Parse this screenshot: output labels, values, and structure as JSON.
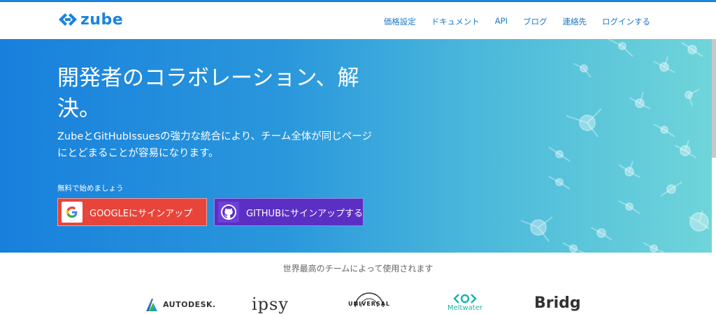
{
  "header": {
    "logo_text": "zube",
    "nav": [
      "価格設定",
      "ドキュメント",
      "API",
      "ブログ",
      "連絡先",
      "ログインする"
    ]
  },
  "hero": {
    "title": "開発者のコラボレーション、解決。",
    "subtitle": "ZubeとGitHubIssuesの強力な統合により、チーム全体が同じページにとどまることが容易になります。",
    "free_label": "無料で始めましょう",
    "google_button": "GOOGLEにサインアップ",
    "github_button": "GITHUBにサインアップする"
  },
  "trust": {
    "caption": "世界最高のチームによって使用されます",
    "logos": [
      "AUTODESK.",
      "ipsy",
      "UNIVERSAL",
      "Meltwater",
      "Bridg"
    ]
  },
  "colors": {
    "brand": "#1a84dd",
    "google_red": "#e8443a",
    "github_purple": "#5b2fc4"
  }
}
